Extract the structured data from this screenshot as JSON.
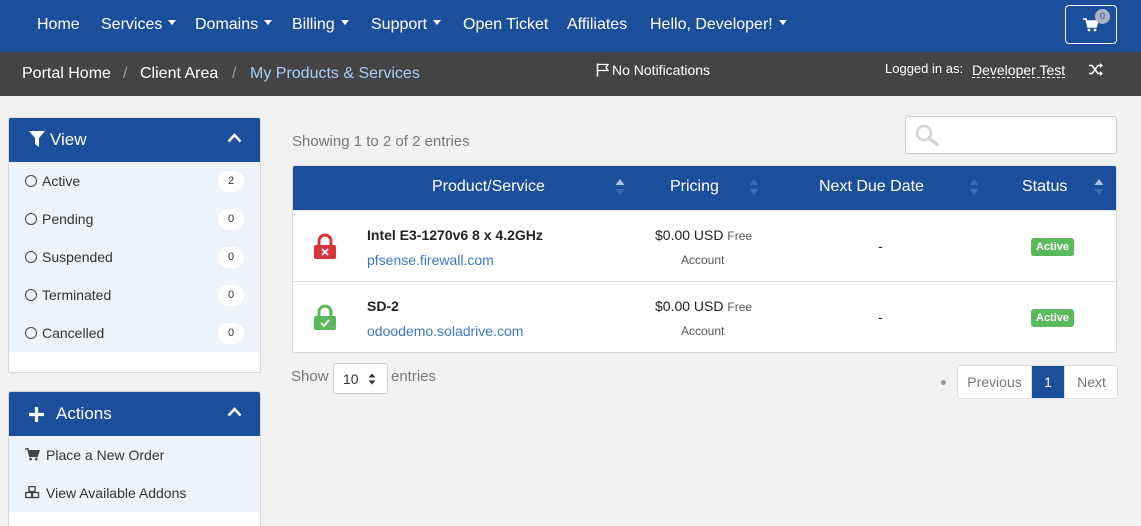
{
  "nav": {
    "home": "Home",
    "services": "Services",
    "domains": "Domains",
    "billing": "Billing",
    "support": "Support",
    "open_ticket": "Open Ticket",
    "affiliates": "Affiliates",
    "hello": "Hello, Developer!",
    "cart_count": "0"
  },
  "breadcrumb": {
    "items": [
      "Portal Home",
      "Client Area",
      "My Products & Services"
    ],
    "separator": "/"
  },
  "notifications": "No Notifications",
  "logged_in": {
    "label": "Logged in as:",
    "user": "Developer Test"
  },
  "sidebar": {
    "view": {
      "title": "View",
      "items": [
        {
          "label": "Active",
          "count": "2"
        },
        {
          "label": "Pending",
          "count": "0"
        },
        {
          "label": "Suspended",
          "count": "0"
        },
        {
          "label": "Terminated",
          "count": "0"
        },
        {
          "label": "Cancelled",
          "count": "0"
        }
      ]
    },
    "actions": {
      "title": "Actions",
      "items": [
        {
          "label": "Place a New Order",
          "icon": "cart-icon"
        },
        {
          "label": "View Available Addons",
          "icon": "cubes-icon"
        }
      ]
    }
  },
  "table": {
    "info": "Showing 1 to 2 of 2 entries",
    "search_value": "",
    "columns": [
      "Product/Service",
      "Pricing",
      "Next Due Date",
      "Status"
    ],
    "rows": [
      {
        "product": "Intel E3-1270v6 8 x 4.2GHz",
        "domain": "pfsense.firewall.com",
        "price": "$0.00 USD",
        "price_note_1": "Free",
        "price_note_2": "Account",
        "due": "-",
        "status": "Active",
        "lock_state": "locked-red"
      },
      {
        "product": "SD-2",
        "domain": "odoodemo.soladrive.com",
        "price": "$0.00 USD",
        "price_note_1": "Free",
        "price_note_2": "Account",
        "due": "-",
        "status": "Active",
        "lock_state": "unlocked-green"
      }
    ]
  },
  "length": {
    "show": "Show",
    "value": "10",
    "entries": "entries"
  },
  "pagination": {
    "previous": "Previous",
    "current": "1",
    "next": "Next"
  },
  "colors": {
    "primary": "#1b4f9c",
    "breadcrumb_bg": "#444444",
    "status_active": "#5cb85c",
    "link": "#3a78c2",
    "lock_red": "#d9343d",
    "lock_green": "#5cb85c"
  }
}
